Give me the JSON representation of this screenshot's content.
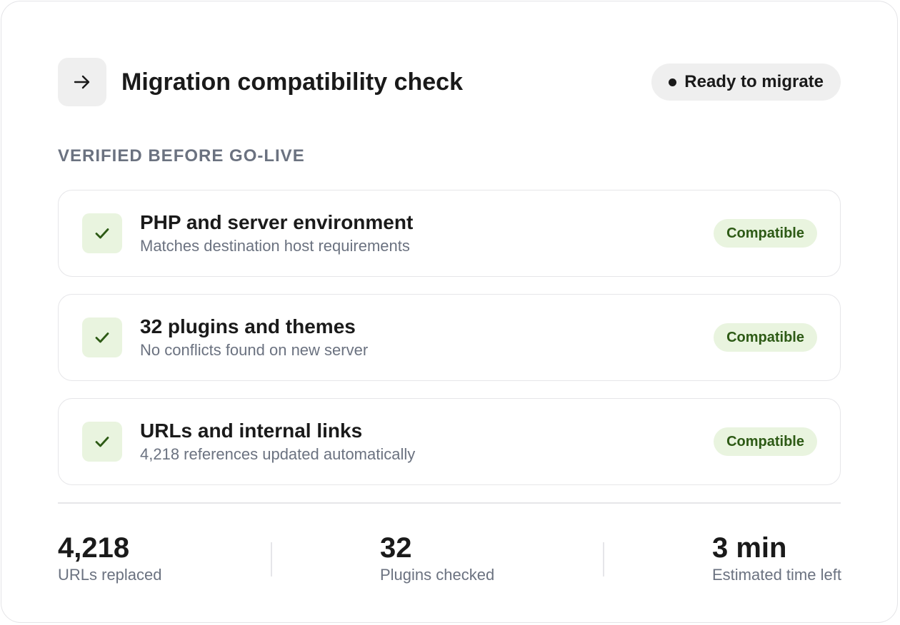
{
  "header": {
    "icon": "arrow-right-icon",
    "title": "Migration compatibility check",
    "status": "Ready to migrate"
  },
  "section_label": "VERIFIED BEFORE GO-LIVE",
  "checks": [
    {
      "icon": "checkmark-icon",
      "title": "PHP and server environment",
      "description": "Matches destination host requirements",
      "badge": "Compatible"
    },
    {
      "icon": "checkmark-icon",
      "title": "32 plugins and themes",
      "description": "No conflicts found on new server",
      "badge": "Compatible"
    },
    {
      "icon": "checkmark-icon",
      "title": "URLs and internal links",
      "description": "4,218 references updated automatically",
      "badge": "Compatible"
    }
  ],
  "stats": [
    {
      "value": "4,218",
      "label": "URLs replaced"
    },
    {
      "value": "32",
      "label": "Plugins checked"
    },
    {
      "value": "3 min",
      "label": "Estimated time left"
    }
  ],
  "colors": {
    "success_bg": "#e9f4df",
    "success_fg": "#2d5a15",
    "muted_text": "#6b7280",
    "neutral_bg": "#efefef"
  }
}
